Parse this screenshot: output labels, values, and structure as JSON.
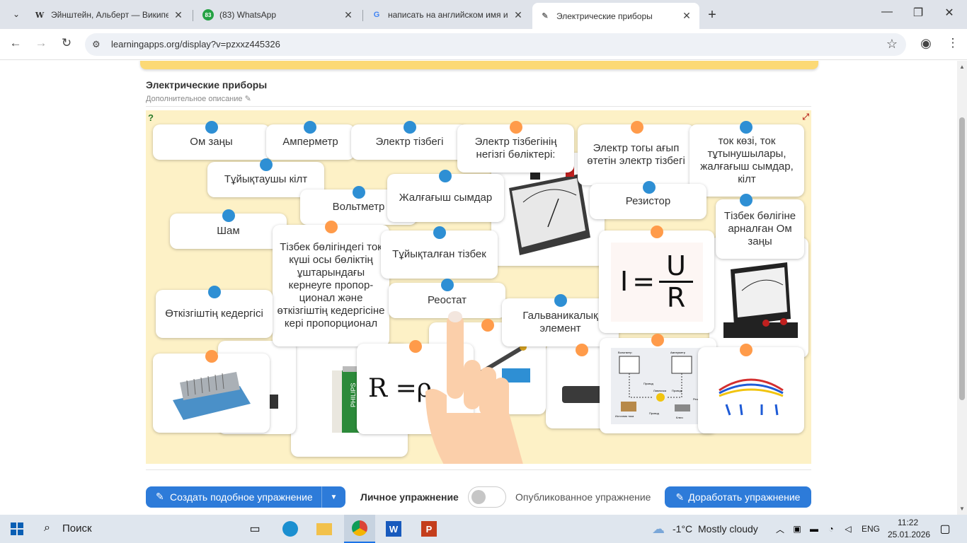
{
  "browser": {
    "tabs": [
      {
        "title": "Эйнштейн, Альберт — Википедия",
        "icon": "wikipedia-icon",
        "glyph": "W"
      },
      {
        "title": "(83) WhatsApp",
        "icon": "whatsapp-icon",
        "glyph": "83"
      },
      {
        "title": "написать на английском имя и ф",
        "icon": "google-icon",
        "glyph": "G"
      },
      {
        "title": "Электрические приборы",
        "icon": "learningapps-icon",
        "glyph": "✎"
      }
    ],
    "new_tab": "+",
    "url": "learningapps.org/display?v=pzxxz445326"
  },
  "app": {
    "title": "Электрические приборы",
    "description": "Дополнительное описание"
  },
  "cards": {
    "om_zany": "Ом заңы",
    "ammeter": "Амперметр",
    "circuit": "Электр тізбегі",
    "main_parts": "Электр тізбегінің негізгі бөліктері:",
    "current_path": "Электр тогы ағып өтетін электр тізбегі",
    "sources": "ток көзі, ток тұтынушылары, жалғағыш сымдар, кілт",
    "switch_key": "Тұйықтаушы кілт",
    "voltmeter": "Вольтметр",
    "wires": "Жалғағыш сымдар",
    "resistor": "Резистор",
    "ohm_section": "Тізбек бөлігіне арналған Ом заңы",
    "lamp": "Шам",
    "ohm_text": "Тізбек бөлігіндегі ток күші осы бөліктің ұштарындағы кернеуге пропор-ционал және өткізгіштің кедергісіне кері пропорционал",
    "closed_circuit": "Тұйықталған тізбек",
    "rheostat": "Реостат",
    "galvanic": "Гальваникалық элемент",
    "conductor_resistance": "Өткізгіштің кедергісі",
    "formula_i": "I",
    "formula_u": "U",
    "formula_r": "R",
    "formula_r2": "R",
    "formula_rho": "=ρ",
    "diagram_labels": [
      "Вольтметр",
      "Амперметр",
      "Провод",
      "Лампочка",
      "Провод",
      "Реостат",
      "Источник тока",
      "Провод",
      "Ключ"
    ],
    "battery_brand": "PHILIPS"
  },
  "footer": {
    "create_label": "Создать подобное упражнение",
    "private_label": "Личное упражнение",
    "public_label": "Опубликованное упражнение",
    "improve_label": "Доработать упражнение"
  },
  "taskbar": {
    "search": "Поиск",
    "weather_temp": "-1°C",
    "weather_desc": "Mostly cloudy",
    "lang": "ENG",
    "time": "11:22",
    "date": "25.01.2026"
  },
  "colors": {
    "accent_blue": "#2e8fd4",
    "accent_orange": "#ff9b4a",
    "board_bg": "#fdf1c6",
    "button_blue": "#2d7bd9"
  }
}
